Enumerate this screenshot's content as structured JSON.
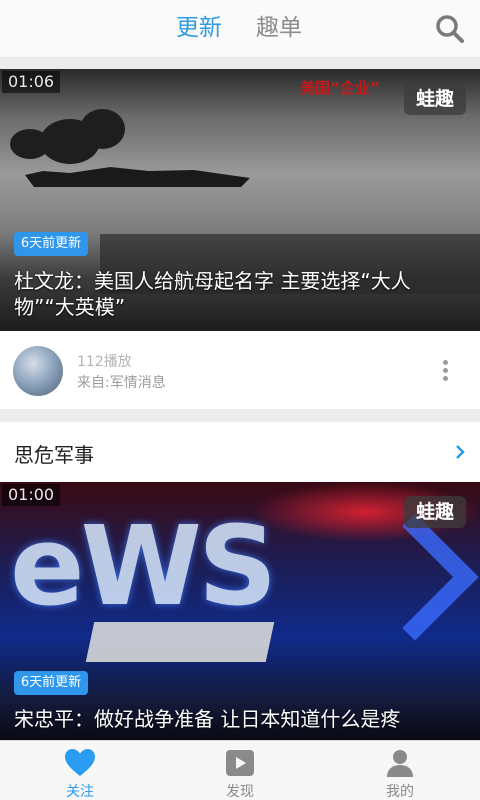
{
  "header": {
    "tabs": [
      {
        "label": "更新",
        "active": true
      },
      {
        "label": "趣单",
        "active": false
      }
    ],
    "search_icon": "search-icon"
  },
  "feed": [
    {
      "duration": "01:06",
      "brand_badge": "蛙趣",
      "update_badge": "6天前更新",
      "title": "杜文龙：美国人给航母起名字 主要选择“大人物”“大英模”",
      "overlay_caption": "美国“企业”",
      "play_count": "112播放",
      "source": "来自:军情消息"
    },
    {
      "section_title": "思危军事",
      "duration": "01:00",
      "brand_badge": "蛙趣",
      "update_badge": "6天前更新",
      "title": "宋忠平：做好战争准备 让日本知道什么是疼"
    }
  ],
  "bottom_nav": [
    {
      "label": "关注",
      "icon": "heart-icon",
      "active": true
    },
    {
      "label": "发现",
      "icon": "play-icon",
      "active": false
    },
    {
      "label": "我的",
      "icon": "user-icon",
      "active": false
    }
  ],
  "colors": {
    "accent": "#2f9be0",
    "badge_blue": "#2e97ec",
    "inactive": "#8c8c8c"
  }
}
